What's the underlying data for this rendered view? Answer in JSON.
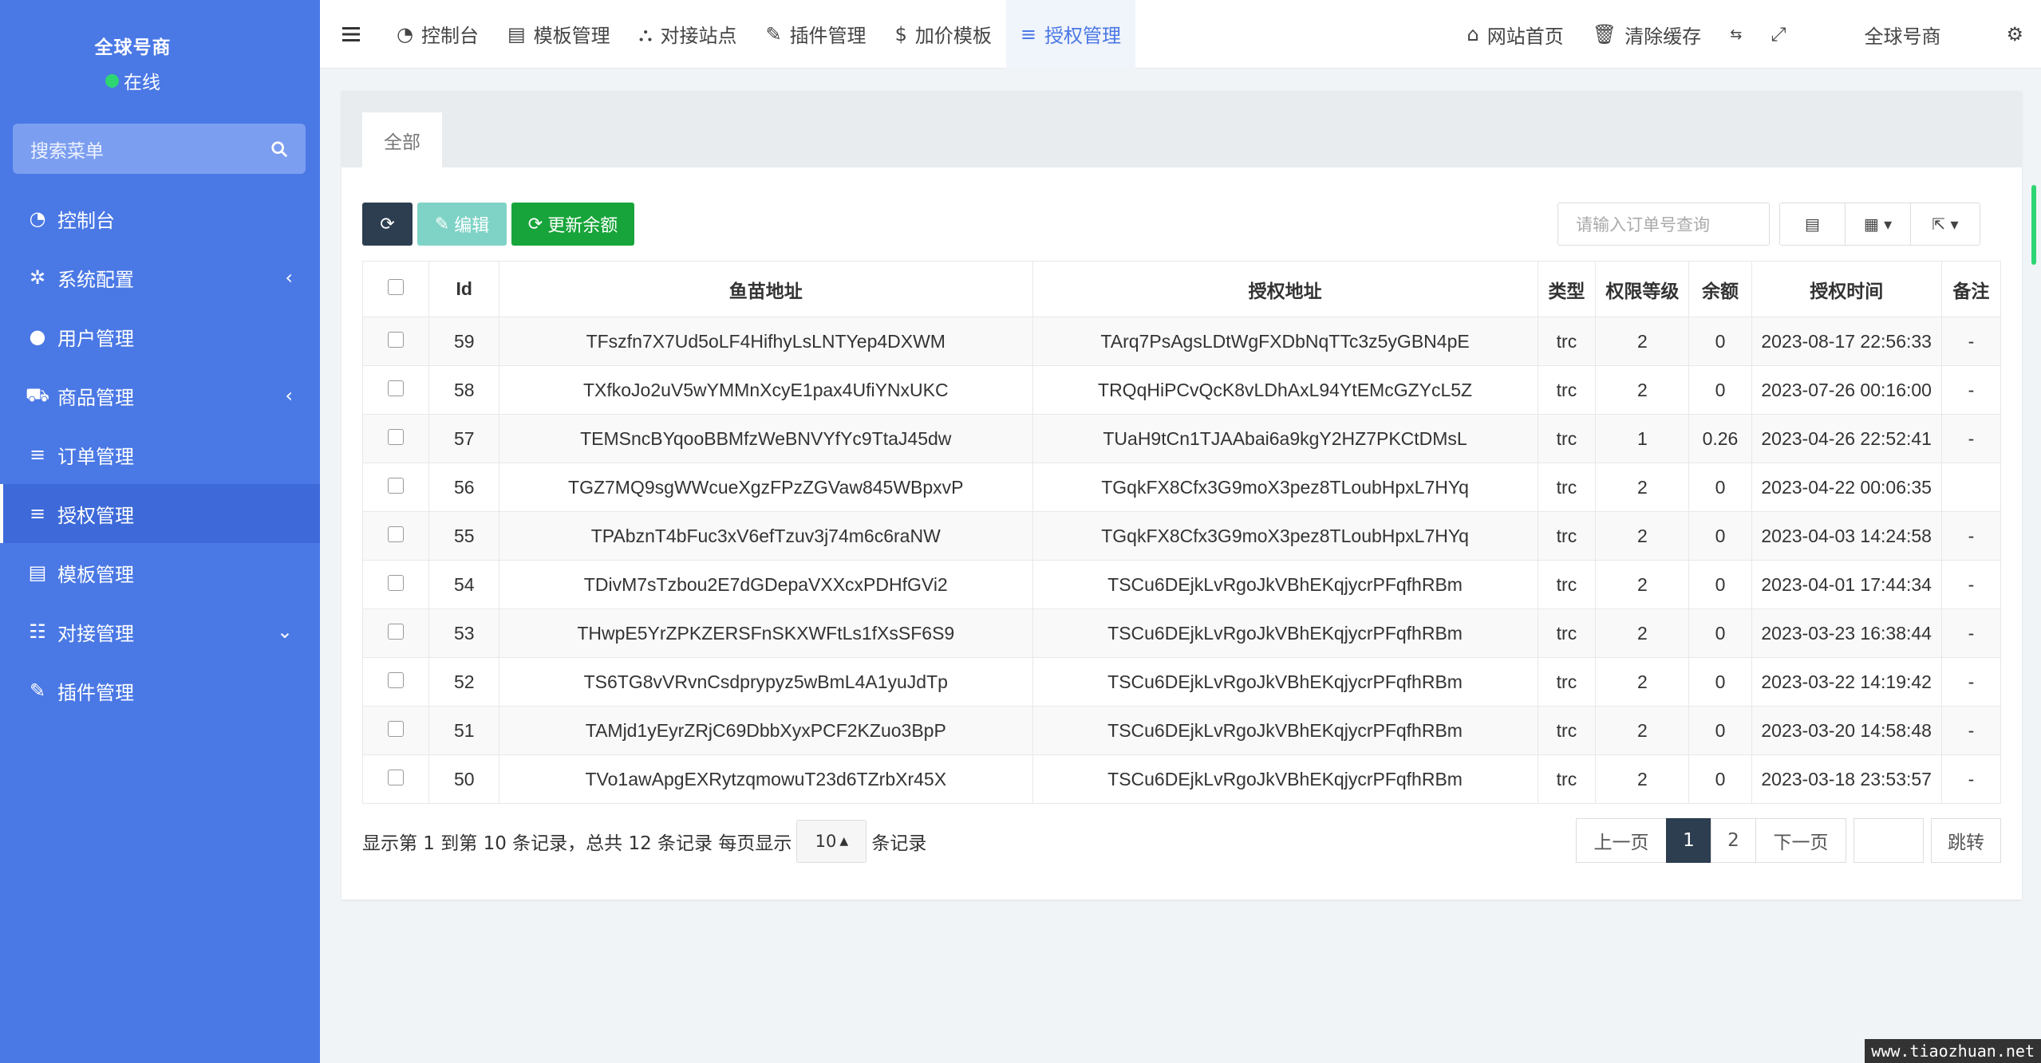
{
  "brand": {
    "name": "全球号商",
    "status": "在线"
  },
  "search": {
    "placeholder": "搜索菜单"
  },
  "menu": [
    {
      "label": "控制台",
      "icon": "dashboard-icon",
      "arrow": ""
    },
    {
      "label": "系统配置",
      "icon": "gear-icon",
      "arrow": "‹"
    },
    {
      "label": "用户管理",
      "icon": "user-icon",
      "arrow": ""
    },
    {
      "label": "商品管理",
      "icon": "cart-icon",
      "arrow": "‹"
    },
    {
      "label": "订单管理",
      "icon": "list-icon",
      "arrow": ""
    },
    {
      "label": "授权管理",
      "icon": "list-icon",
      "arrow": "",
      "active": true
    },
    {
      "label": "模板管理",
      "icon": "template-icon",
      "arrow": ""
    },
    {
      "label": "对接管理",
      "icon": "sliders-icon",
      "arrow": "⌄"
    },
    {
      "label": "插件管理",
      "icon": "plug-icon",
      "arrow": ""
    }
  ],
  "topbar": {
    "tabs": [
      {
        "label": "控制台",
        "icon": "dashboard-icon"
      },
      {
        "label": "模板管理",
        "icon": "template-icon"
      },
      {
        "label": "对接站点",
        "icon": "sitemap-icon"
      },
      {
        "label": "插件管理",
        "icon": "plug-icon"
      },
      {
        "label": "加价模板",
        "icon": "dollar-icon"
      },
      {
        "label": "授权管理",
        "icon": "list-icon",
        "active": true
      }
    ],
    "home": "网站首页",
    "clear_cache": "清除缓存",
    "user": "全球号商"
  },
  "page": {
    "tab": "全部",
    "btn_edit": "编辑",
    "btn_update": "更新余额",
    "query_placeholder": "请输入订单号查询"
  },
  "table": {
    "headers": [
      "Id",
      "鱼苗地址",
      "授权地址",
      "类型",
      "权限等级",
      "余额",
      "授权时间",
      "备注"
    ],
    "rows": [
      [
        "59",
        "TFszfn7X7Ud5oLF4HifhyLsLNTYep4DXWM",
        "TArq7PsAgsLDtWgFXDbNqTTc3z5yGBN4pE",
        "trc",
        "2",
        "0",
        "2023-08-17 22:56:33",
        "-"
      ],
      [
        "58",
        "TXfkoJo2uV5wYMMnXcyE1pax4UfiYNxUKC",
        "TRQqHiPCvQcK8vLDhAxL94YtEMcGZYcL5Z",
        "trc",
        "2",
        "0",
        "2023-07-26 00:16:00",
        "-"
      ],
      [
        "57",
        "TEMSncBYqooBBMfzWeBNVYfYc9TtaJ45dw",
        "TUaH9tCn1TJAAbai6a9kgY2HZ7PKCtDMsL",
        "trc",
        "1",
        "0.26",
        "2023-04-26 22:52:41",
        "-"
      ],
      [
        "56",
        "TGZ7MQ9sgWWcueXgzFPzZGVaw845WBpxvP",
        "TGqkFX8Cfx3G9moX3pez8TLoubHpxL7HYq",
        "trc",
        "2",
        "0",
        "2023-04-22 00:06:35",
        ""
      ],
      [
        "55",
        "TPAbznT4bFuc3xV6efTzuv3j74m6c6raNW",
        "TGqkFX8Cfx3G9moX3pez8TLoubHpxL7HYq",
        "trc",
        "2",
        "0",
        "2023-04-03 14:24:58",
        "-"
      ],
      [
        "54",
        "TDivM7sTzbou2E7dGDepaVXXcxPDHfGVi2",
        "TSCu6DEjkLvRgoJkVBhEKqjycrPFqfhRBm",
        "trc",
        "2",
        "0",
        "2023-04-01 17:44:34",
        "-"
      ],
      [
        "53",
        "THwpE5YrZPKZERSFnSKXWFtLs1fXsSF6S9",
        "TSCu6DEjkLvRgoJkVBhEKqjycrPFqfhRBm",
        "trc",
        "2",
        "0",
        "2023-03-23 16:38:44",
        "-"
      ],
      [
        "52",
        "TS6TG8vVRvnCsdprypyz5wBmL4A1yuJdTp",
        "TSCu6DEjkLvRgoJkVBhEKqjycrPFqfhRBm",
        "trc",
        "2",
        "0",
        "2023-03-22 14:19:42",
        "-"
      ],
      [
        "51",
        "TAMjd1yEyrZRjC69DbbXyxPCF2KZuo3BpP",
        "TSCu6DEjkLvRgoJkVBhEKqjycrPFqfhRBm",
        "trc",
        "2",
        "0",
        "2023-03-20 14:58:48",
        "-"
      ],
      [
        "50",
        "TVo1awApgEXRytzqmowuT23d6TZrbXr45X",
        "TSCu6DEjkLvRgoJkVBhEKqjycrPFqfhRBm",
        "trc",
        "2",
        "0",
        "2023-03-18 23:53:57",
        "-"
      ]
    ]
  },
  "footer": {
    "summary_prefix": "显示第 1 到第 10 条记录，总共 12 条记录 每页显示",
    "page_size": "10",
    "summary_suffix": "条记录",
    "prev": "上一页",
    "pages": [
      "1",
      "2"
    ],
    "current_page": "1",
    "next": "下一页",
    "jump": "跳转"
  },
  "watermark": "www.tiaozhuan.net"
}
